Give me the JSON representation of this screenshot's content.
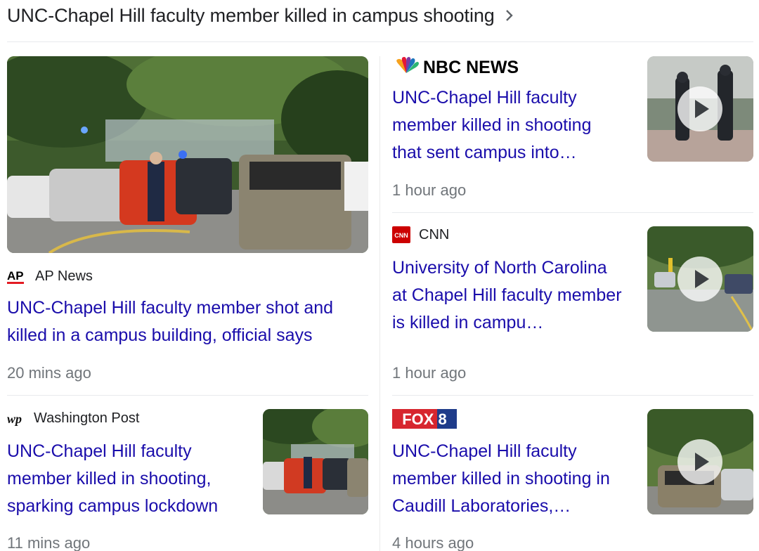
{
  "header": {
    "title": "UNC-Chapel Hill faculty member killed in campus shooting",
    "chevron_icon": "chevron-right-icon"
  },
  "stories": {
    "featured": {
      "source": "AP News",
      "source_logo_text": "AP",
      "source_logo_color": "#000000",
      "source_logo_accent": "#e31b23",
      "headline": "UNC-Chapel Hill faculty member shot and killed in a campus building, official says",
      "time": "20 mins ago",
      "image": "police-scene-street-image"
    },
    "wapo": {
      "source": "Washington Post",
      "source_logo_text": "wp",
      "headline": "UNC-Chapel Hill faculty member killed in shooting, sparking campus lockdown",
      "time": "11 mins ago",
      "image": "police-scene-street-image"
    },
    "nbc": {
      "source_logo_text": "NBC NEWS",
      "headline": "UNC-Chapel Hill faculty member killed in shooting that sent campus into…",
      "time": "1 hour ago",
      "image": "officers-video-thumbnail",
      "has_video": true
    },
    "cnn": {
      "source": "CNN",
      "source_logo_text": "CNN",
      "source_logo_color": "#cc0000",
      "headline": "University of North Carolina at Chapel Hill faculty member is killed in campu…",
      "time": "1 hour ago",
      "image": "campus-road-video-thumbnail",
      "has_video": true
    },
    "fox8": {
      "source_logo_text": "FOX 8",
      "source_logo_color": "#d7262e",
      "source_logo_accent": "#1f3c8a",
      "headline": "UNC-Chapel Hill faculty member killed in shooting in Caudill Laboratories,…",
      "time": "4 hours ago",
      "image": "suv-street-video-thumbnail",
      "has_video": true
    }
  },
  "colors": {
    "link": "#1a0dab",
    "meta": "#70757a",
    "divider": "#e8eaed"
  }
}
